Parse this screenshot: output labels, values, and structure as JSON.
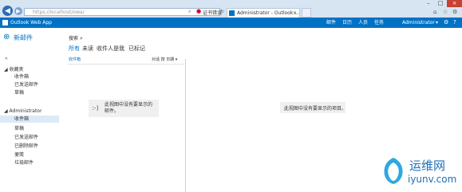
{
  "browser": {
    "url": "https://localhost/owa/",
    "cert_error": "证书错误",
    "tab_title": "Administrator - Outlook ...",
    "back_icon": "back-arrow-icon",
    "forward_icon": "forward-arrow-icon"
  },
  "header": {
    "app_title": "Outlook Web App",
    "nav": [
      "邮件",
      "日历",
      "人员",
      "任务"
    ],
    "user": "Administrator",
    "user_chevron": "▾"
  },
  "left": {
    "new_mail": "新邮件",
    "favorites_title": "收藏夹",
    "favorites": [
      "收件箱",
      "已发送邮件",
      "草稿"
    ],
    "account_title": "Administrator",
    "folders": [
      "收件箱",
      "草稿",
      "已发送邮件",
      "已删除邮件",
      "便笺",
      "垃圾邮件"
    ],
    "selected_folder_index": 0
  },
  "search": {
    "label": "搜索"
  },
  "filters": [
    "所有",
    "未读",
    "收件人是我",
    "已标记"
  ],
  "list": {
    "folder_label": "收件箱",
    "sort_label": "对话 按 日期",
    "empty_face": ":-)",
    "empty_text": "此视图中没有要显示的邮件。"
  },
  "reading_pane": {
    "empty_text": "此视图中没有要显示的项目。"
  },
  "watermark": {
    "text": "运维网",
    "url": "iyunv.com"
  },
  "colors": {
    "brand_blue": "#0072c6",
    "chrome_bg": "#d7e4f2",
    "selection": "#dceaf8"
  }
}
